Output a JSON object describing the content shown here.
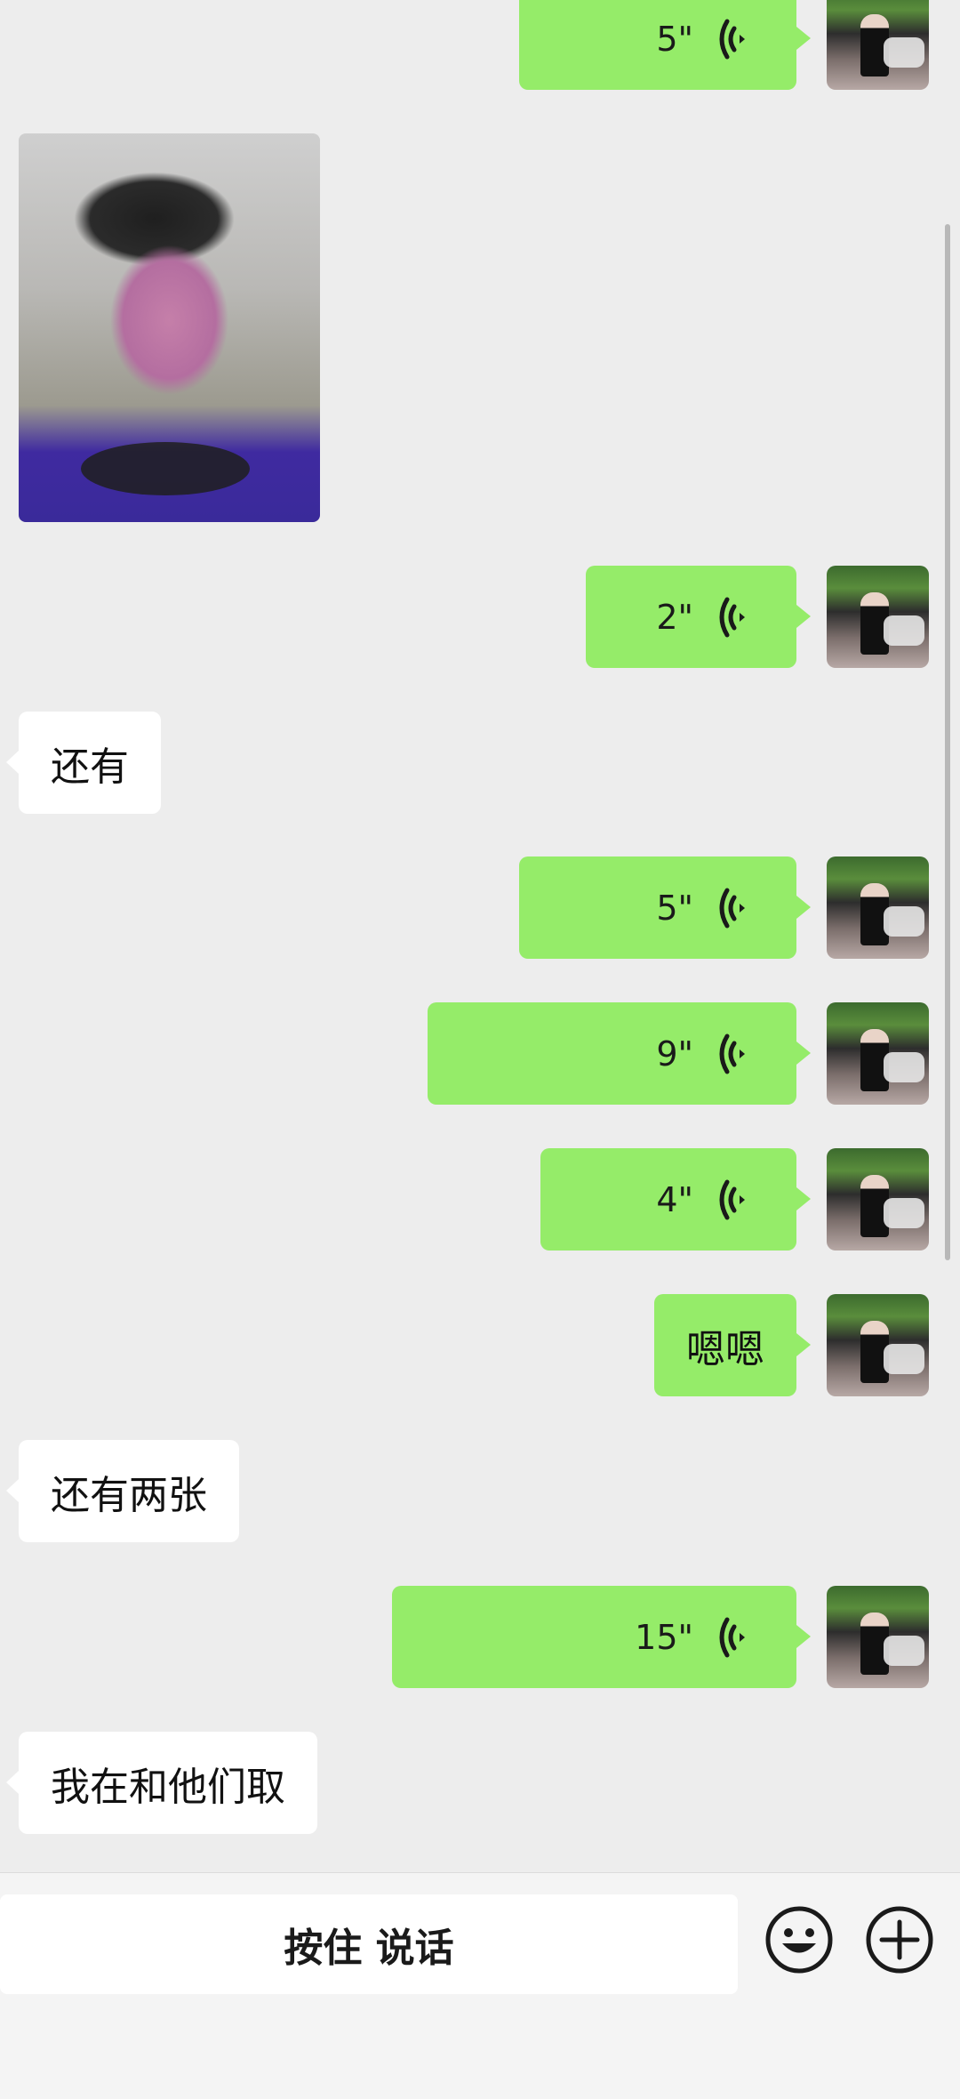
{
  "messages": [
    {
      "type": "voice",
      "side": "sent",
      "duration": "5\""
    },
    {
      "type": "image",
      "side": "received"
    },
    {
      "type": "voice",
      "side": "sent",
      "duration": "2\""
    },
    {
      "type": "text",
      "side": "received",
      "text": "还有"
    },
    {
      "type": "voice",
      "side": "sent",
      "duration": "5\""
    },
    {
      "type": "voice",
      "side": "sent",
      "duration": "9\""
    },
    {
      "type": "voice",
      "side": "sent",
      "duration": "4\""
    },
    {
      "type": "text",
      "side": "sent",
      "text": "嗯嗯"
    },
    {
      "type": "text",
      "side": "received",
      "text": "还有两张"
    },
    {
      "type": "voice",
      "side": "sent",
      "duration": "15\""
    },
    {
      "type": "text",
      "side": "received",
      "text": "我在和他们取"
    }
  ],
  "input_bar": {
    "hold_to_talk_label": "按住 说话",
    "icons": [
      "emoji-icon",
      "plus-icon"
    ]
  },
  "colors": {
    "sent_bubble": "#95ec69",
    "received_bubble": "#ffffff",
    "background": "#ededed"
  }
}
